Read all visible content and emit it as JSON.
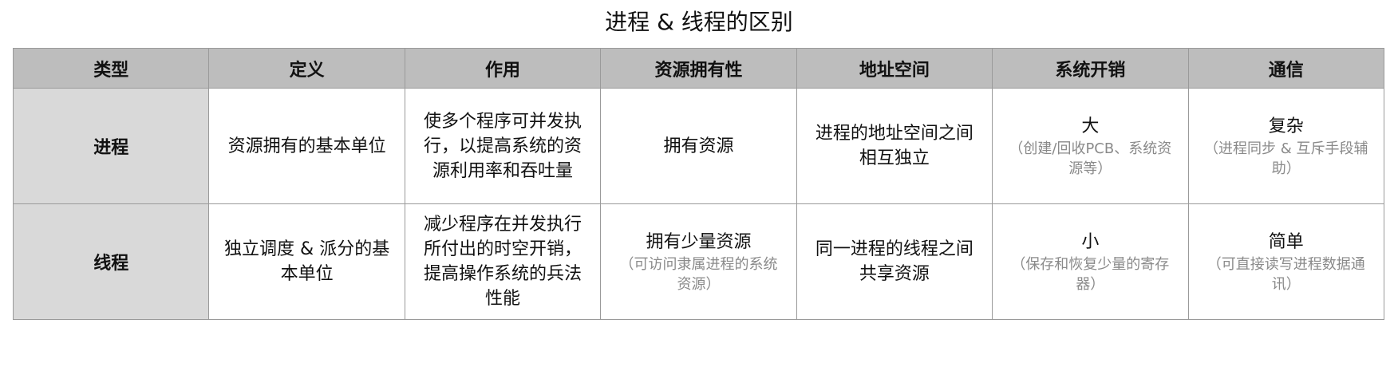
{
  "title": "进程 & 线程的区别",
  "headers": [
    "类型",
    "定义",
    "作用",
    "资源拥有性",
    "地址空间",
    "系统开销",
    "通信"
  ],
  "rows": [
    {
      "type": "进程",
      "definition": "资源拥有的基本单位",
      "purpose": "使多个程序可并发执行，以提高系统的资源利用率和吞吐量",
      "resource": {
        "main": "拥有资源",
        "note": ""
      },
      "address_space": "进程的地址空间之间相互独立",
      "overhead": {
        "main": "大",
        "note": "（创建/回收PCB、系统资源等）"
      },
      "communication": {
        "main": "复杂",
        "note": "（进程同步 & 互斥手段辅助）"
      }
    },
    {
      "type": "线程",
      "definition": "独立调度 & 派分的基本单位",
      "purpose": "减少程序在并发执行所付出的时空开销，提高操作系统的兵法性能",
      "resource": {
        "main": "拥有少量资源",
        "note": "（可访问隶属进程的系统资源）"
      },
      "address_space": "同一进程的线程之间共享资源",
      "overhead": {
        "main": "小",
        "note": "（保存和恢复少量的寄存器）"
      },
      "communication": {
        "main": "简单",
        "note": "（可直接读写进程数据通讯）"
      }
    }
  ]
}
